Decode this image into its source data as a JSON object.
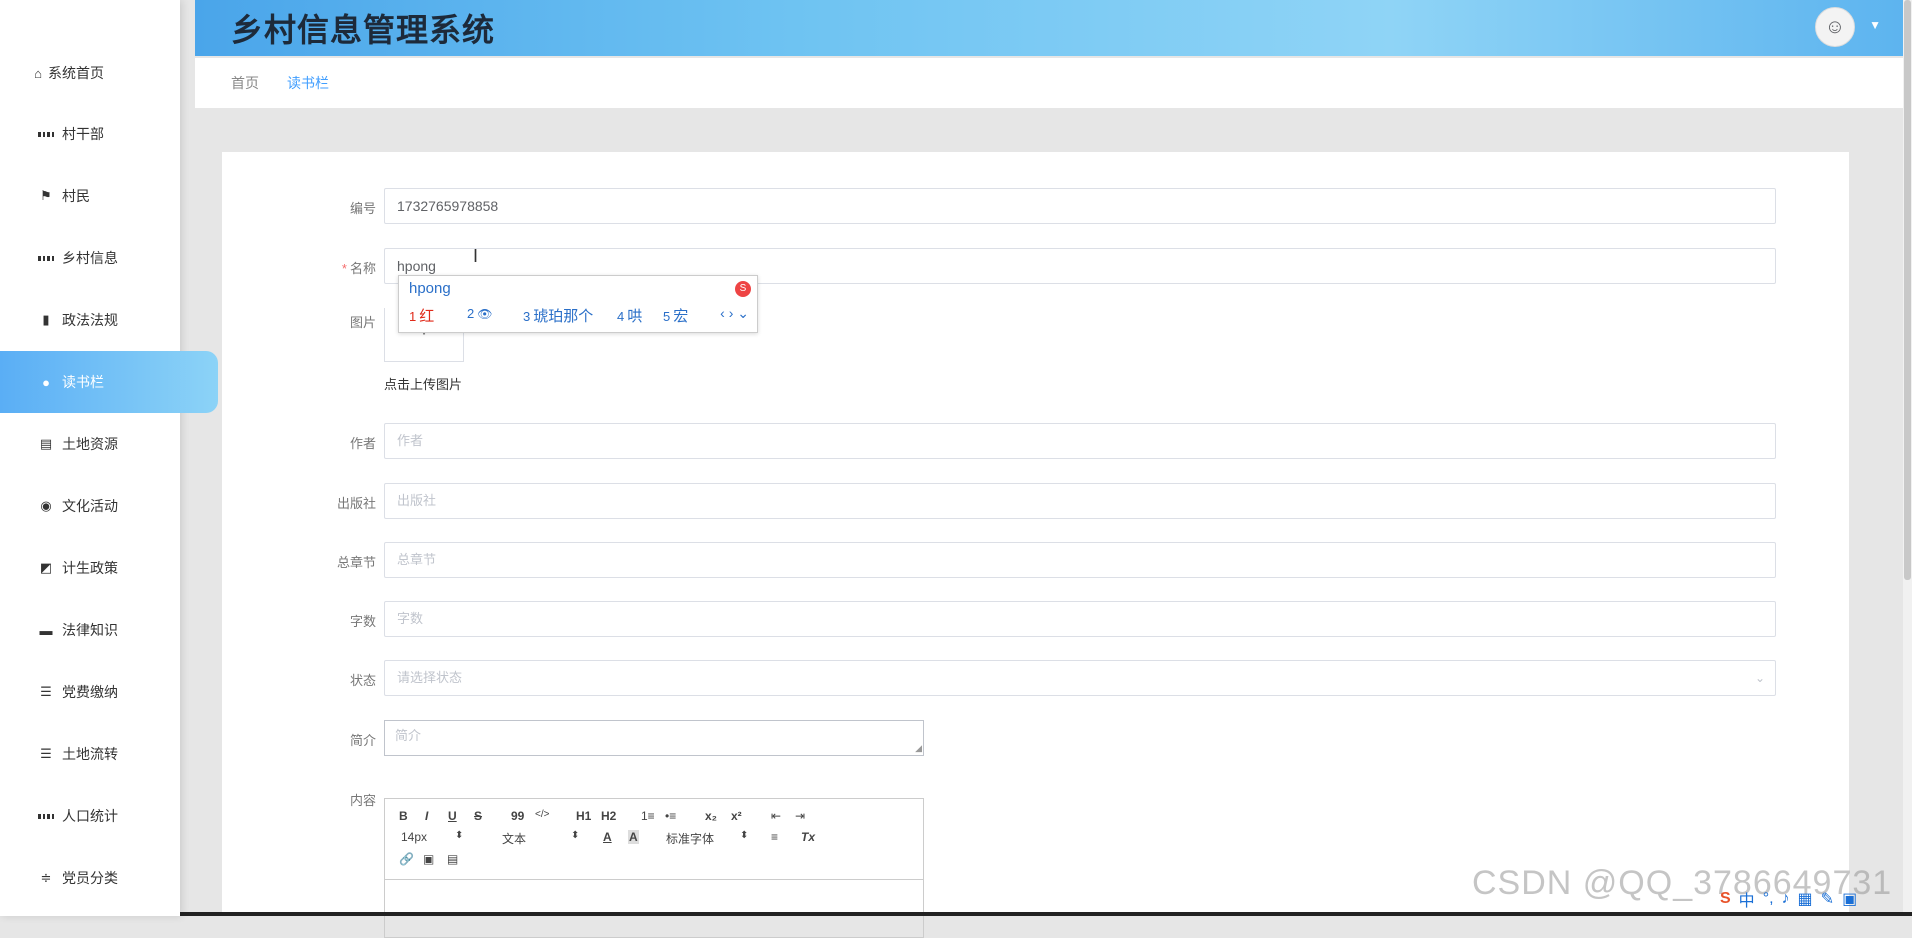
{
  "app": {
    "title": "乡村信息管理系统"
  },
  "sidebar": {
    "items": [
      {
        "label": "系统首页",
        "icon": "home-icon"
      },
      {
        "label": "村干部",
        "icon": "grid-icon"
      },
      {
        "label": "村民",
        "icon": "flag-icon"
      },
      {
        "label": "乡村信息",
        "icon": "grid-icon"
      },
      {
        "label": "政法法规",
        "icon": "bar-chart-icon"
      },
      {
        "label": "读书栏",
        "icon": "user-icon",
        "active": true
      },
      {
        "label": "土地资源",
        "icon": "clipboard-icon"
      },
      {
        "label": "文化活动",
        "icon": "pin-icon"
      },
      {
        "label": "计生政策",
        "icon": "trend-chart-icon"
      },
      {
        "label": "法律知识",
        "icon": "briefcase-icon"
      },
      {
        "label": "党费缴纳",
        "icon": "list-icon"
      },
      {
        "label": "土地流转",
        "icon": "list-icon"
      },
      {
        "label": "人口统计",
        "icon": "grid-icon"
      },
      {
        "label": "党员分类",
        "icon": "sliders-icon"
      }
    ]
  },
  "breadcrumb": {
    "home": "首页",
    "current": "读书栏"
  },
  "form": {
    "id": {
      "label": "编号",
      "value": "1732765978858"
    },
    "name": {
      "label": "名称",
      "required": "*",
      "value": "hpong"
    },
    "image": {
      "label": "图片",
      "plus": "+",
      "hint": "点击上传图片"
    },
    "author": {
      "label": "作者",
      "placeholder": "作者"
    },
    "publisher": {
      "label": "出版社",
      "placeholder": "出版社"
    },
    "chapters": {
      "label": "总章节",
      "placeholder": "总章节"
    },
    "words": {
      "label": "字数",
      "placeholder": "字数"
    },
    "status": {
      "label": "状态",
      "placeholder": "请选择状态"
    },
    "intro": {
      "label": "简介",
      "placeholder": "简介"
    },
    "content": {
      "label": "内容"
    }
  },
  "editor": {
    "bold": "B",
    "italic": "I",
    "underline": "U",
    "strike": "S",
    "quote": "99",
    "code": "</>",
    "h1": "H1",
    "h2": "H2",
    "ol": "1≡",
    "ul": "•≡",
    "sub": "x₂",
    "sup": "x²",
    "outdent": "⇤",
    "indent": "⇥",
    "size": "14px",
    "size_arrow": "⬍",
    "type": "文本",
    "type_arrow": "⬍",
    "color": "A",
    "bg": "A",
    "font": "标准字体",
    "font_arrow": "⬍",
    "align": "≡",
    "clear": "Tx",
    "link": "🔗",
    "image": "▣",
    "video": "▤"
  },
  "ime": {
    "composition": "hpong",
    "candidates": [
      {
        "n": "1",
        "text": "红"
      },
      {
        "n": "2",
        "text": "👁"
      },
      {
        "n": "3",
        "text": "琥珀那个"
      },
      {
        "n": "4",
        "text": "哄"
      },
      {
        "n": "5",
        "text": "宏"
      }
    ],
    "nav": "‹ › ⌄"
  },
  "watermark": "CSDN @QQ_3786649731",
  "taskbar": {
    "ime_mode": "中"
  },
  "colors": {
    "accent": "#5aaef5",
    "header_start": "#4aa5ea",
    "breadcrumb_active": "#409eff"
  }
}
